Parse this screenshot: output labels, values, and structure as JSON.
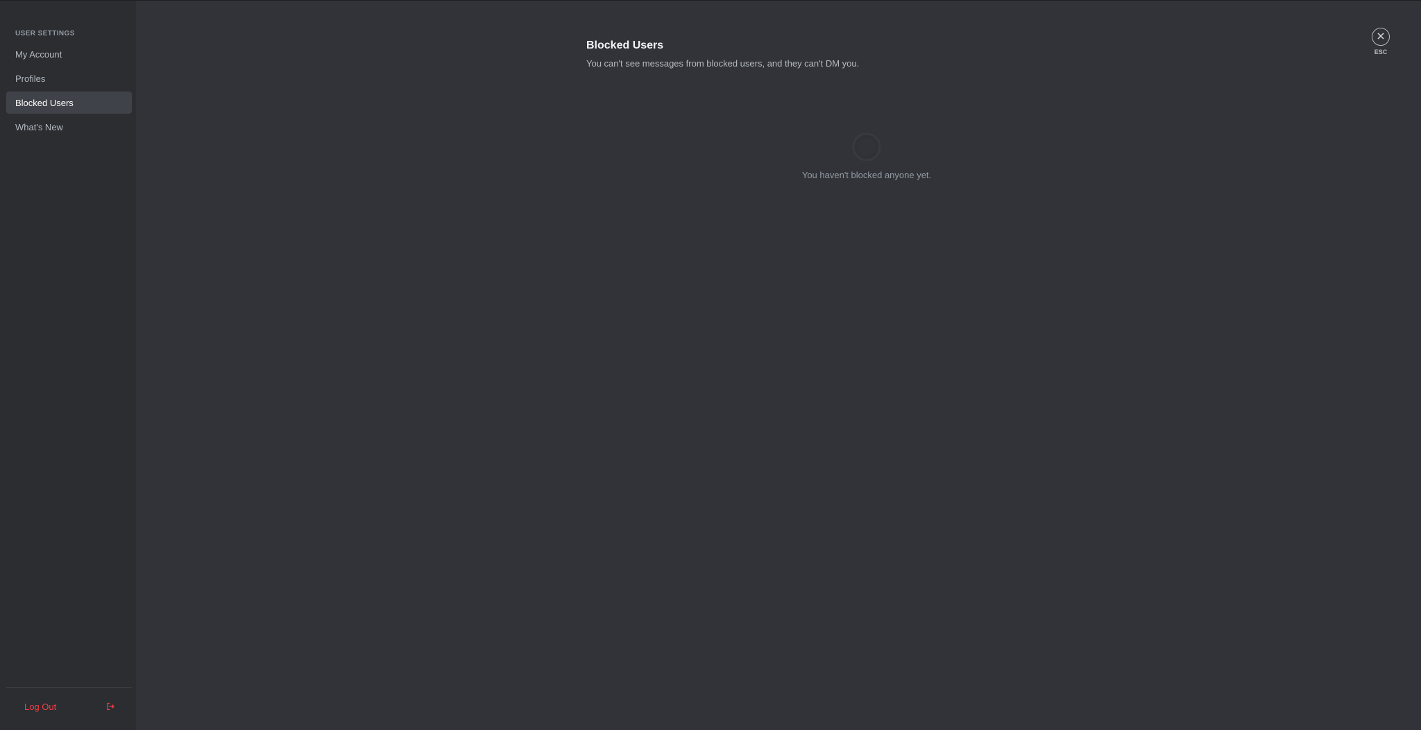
{
  "sidebar": {
    "header": "USER SETTINGS",
    "items": [
      {
        "label": "My Account",
        "active": false
      },
      {
        "label": "Profiles",
        "active": false
      },
      {
        "label": "Blocked Users",
        "active": true
      },
      {
        "label": "What's New",
        "active": false
      }
    ],
    "logout_label": "Log Out",
    "logout_icon": "logout-icon"
  },
  "main": {
    "title": "Blocked Users",
    "subtitle": "You can't see messages from blocked users, and they can't DM you.",
    "empty_state": {
      "icon": "blocked-users-empty-icon",
      "text": "You haven't blocked anyone yet."
    }
  },
  "close": {
    "icon": "close-icon",
    "label": "ESC"
  },
  "colors": {
    "background": "#313338",
    "sidebar": "#2b2d31",
    "active_item": "#404249",
    "danger": "#f23f43"
  }
}
